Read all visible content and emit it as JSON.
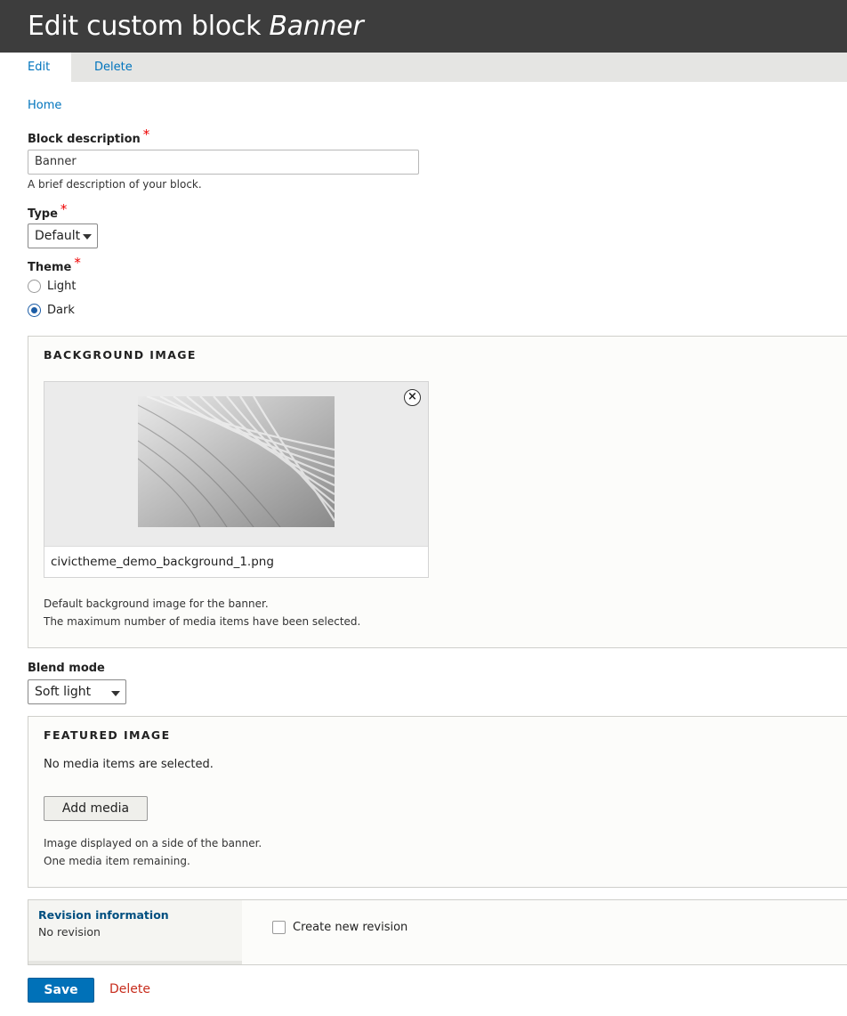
{
  "header": {
    "title_prefix": "Edit custom block ",
    "title_entity": "Banner"
  },
  "tabs": [
    {
      "label": "Edit",
      "active": true
    },
    {
      "label": "Delete",
      "active": false
    }
  ],
  "breadcrumb": {
    "home": "Home"
  },
  "form": {
    "block_description": {
      "label": "Block description",
      "required_mark": "*",
      "value": "Banner",
      "help": "A brief description of your block."
    },
    "type": {
      "label": "Type",
      "required_mark": "*",
      "selected": "Default"
    },
    "theme": {
      "label": "Theme",
      "required_mark": "*",
      "options": [
        {
          "label": "Light",
          "checked": false
        },
        {
          "label": "Dark",
          "checked": true
        }
      ]
    },
    "background_image": {
      "legend": "BACKGROUND IMAGE",
      "file_name": "civictheme_demo_background_1.png",
      "remove_icon": "close-circle-icon",
      "help_1": "Default background image for the banner.",
      "help_2": "The maximum number of media items have been selected."
    },
    "blend_mode": {
      "label": "Blend mode",
      "selected": "Soft light"
    },
    "featured_image": {
      "legend": "FEATURED IMAGE",
      "empty_text": "No media items are selected.",
      "add_button": "Add media",
      "help_1": "Image displayed on a side of the banner.",
      "help_2": "One media item remaining."
    },
    "revision": {
      "title": "Revision information",
      "summary": "No revision",
      "checkbox_label": "Create new revision",
      "checked": false
    }
  },
  "actions": {
    "save": "Save",
    "delete": "Delete"
  },
  "colors": {
    "header_bg": "#3d3d3d",
    "link": "#0074bd",
    "primary_button": "#0071b8",
    "danger": "#c72c1c",
    "required": "#e00000"
  }
}
